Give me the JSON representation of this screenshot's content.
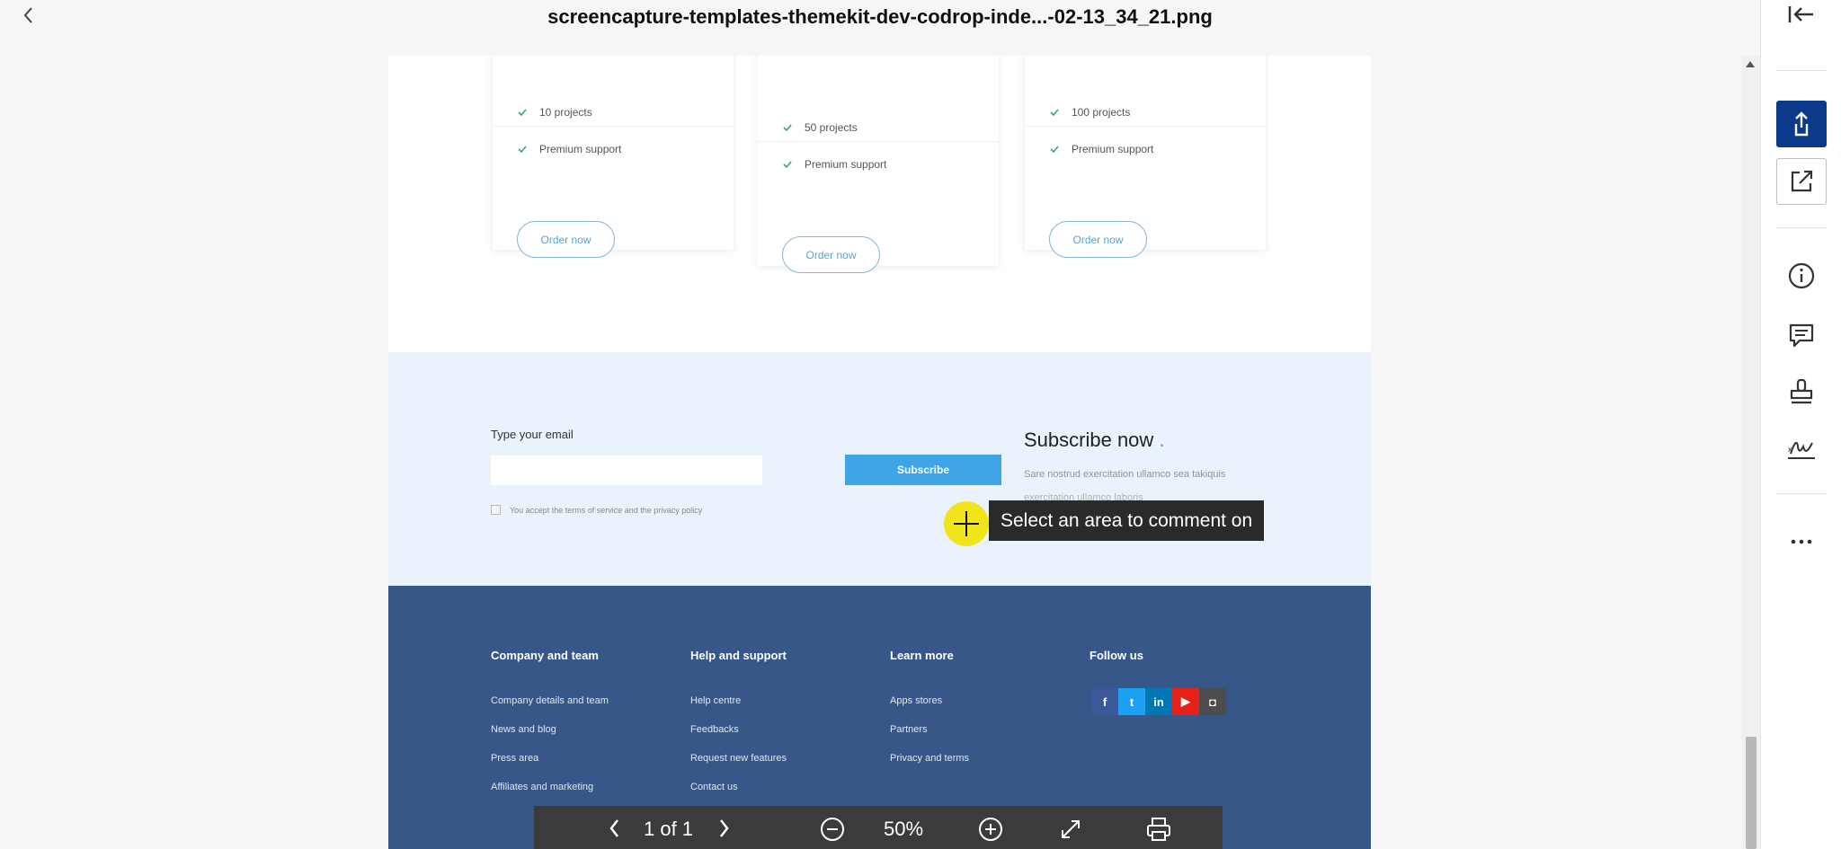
{
  "window": {
    "title": "screencapture-templates-themekit-dev-codrop-inde...-02-13_34_21.png"
  },
  "pricing": {
    "cards": [
      {
        "features": [
          "10 projects",
          "Premium support"
        ],
        "button": "Order now"
      },
      {
        "features": [
          "50 projects",
          "Premium support"
        ],
        "button": "Order now"
      },
      {
        "features": [
          "100 projects",
          "Premium support"
        ],
        "button": "Order now"
      }
    ]
  },
  "subscribe": {
    "email_label": "Type your email",
    "email_value": "",
    "button": "Subscribe",
    "terms": "You accept the terms of service and the privacy policy",
    "heading": "Subscribe now",
    "heading_dot": ".",
    "text": "Sare nostrud exercitation ullamco sea takiquis",
    "text2": "exercitation ullamco laboris"
  },
  "footer": {
    "columns": [
      {
        "heading": "Company and team",
        "links": [
          "Company details and team",
          "News and blog",
          "Press area",
          "Affiliates and marketing"
        ]
      },
      {
        "heading": "Help and support",
        "links": [
          "Help centre",
          "Feedbacks",
          "Request new features",
          "Contact us"
        ]
      },
      {
        "heading": "Learn more",
        "links": [
          "Apps stores",
          "Partners",
          "Privacy and terms"
        ]
      },
      {
        "heading": "Follow us",
        "links": []
      }
    ],
    "social": [
      {
        "icon": "facebook-icon",
        "glyph": "f",
        "color": "#3b5998"
      },
      {
        "icon": "twitter-icon",
        "glyph": "t",
        "color": "#1da1f2"
      },
      {
        "icon": "linkedin-icon",
        "glyph": "in",
        "color": "#0077b5"
      },
      {
        "icon": "youtube-icon",
        "glyph": "▶",
        "color": "#e62117"
      },
      {
        "icon": "instagram-icon",
        "glyph": "◘",
        "color": "#4d4d4d"
      }
    ]
  },
  "tooltip": {
    "text": "Select an area to comment on"
  },
  "viewer_controls": {
    "page_display": "1 of 1",
    "zoom": "50%"
  },
  "colors": {
    "accent": "#0b3a8a",
    "footer_bg": "#375789",
    "subscribe_bg": "#eaf3fb",
    "button_blue": "#3fa4e6",
    "highlight": "#f2e41b"
  }
}
